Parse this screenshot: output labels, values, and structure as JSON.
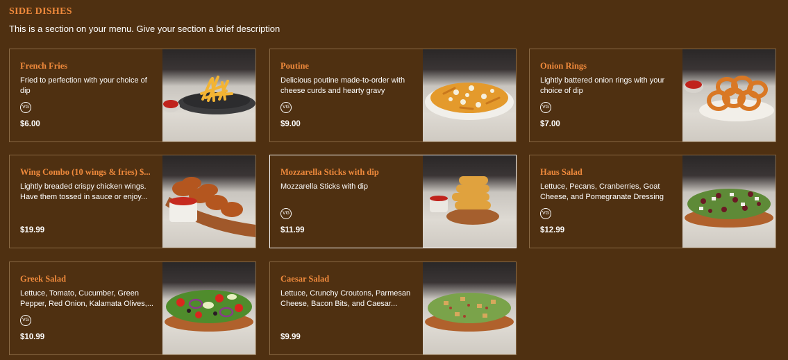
{
  "section": {
    "title": "SIDE DISHES",
    "description": "This is a section on your menu. Give your section a brief description"
  },
  "vg_label": "VG",
  "items": [
    {
      "name": "French Fries",
      "description": "Fried to perfection with your choice of dip",
      "price": "$6.00",
      "vg": true,
      "photo": "french-fries-photo"
    },
    {
      "name": "Poutine",
      "description": "Delicious poutine made-to-order with cheese curds and hearty gravy",
      "price": "$9.00",
      "vg": true,
      "photo": "poutine-photo"
    },
    {
      "name": "Onion Rings",
      "description": "Lightly battered onion rings with your choice of dip",
      "price": "$7.00",
      "vg": true,
      "photo": "onion-rings-photo"
    },
    {
      "name": "Wing Combo (10 wings & fries) $...",
      "description": "Lightly breaded crispy chicken wings. Have them tossed in sauce or enjoy...",
      "price": "$19.99",
      "vg": false,
      "photo": "wing-combo-photo"
    },
    {
      "name": "Mozzarella Sticks with dip",
      "description": "Mozzarella Sticks with dip",
      "price": "$11.99",
      "vg": true,
      "photo": "mozzarella-sticks-photo"
    },
    {
      "name": "Haus Salad",
      "description": "Lettuce, Pecans, Cranberries, Goat Cheese, and Pomegranate Dressing",
      "price": "$12.99",
      "vg": true,
      "photo": "haus-salad-photo"
    },
    {
      "name": "Greek Salad",
      "description": "Lettuce, Tomato, Cucumber, Green Pepper, Red Onion, Kalamata Olives,...",
      "price": "$10.99",
      "vg": true,
      "photo": "greek-salad-photo"
    },
    {
      "name": "Caesar Salad",
      "description": "Lettuce, Crunchy Croutons, Parmesan Cheese, Bacon Bits, and Caesar...",
      "price": "$9.99",
      "vg": false,
      "photo": "caesar-salad-photo"
    }
  ],
  "colors": {
    "background": "#4f3011",
    "accent": "#f08a3c",
    "card_border": "#8a6a45",
    "selected_border": "#ffffff"
  }
}
